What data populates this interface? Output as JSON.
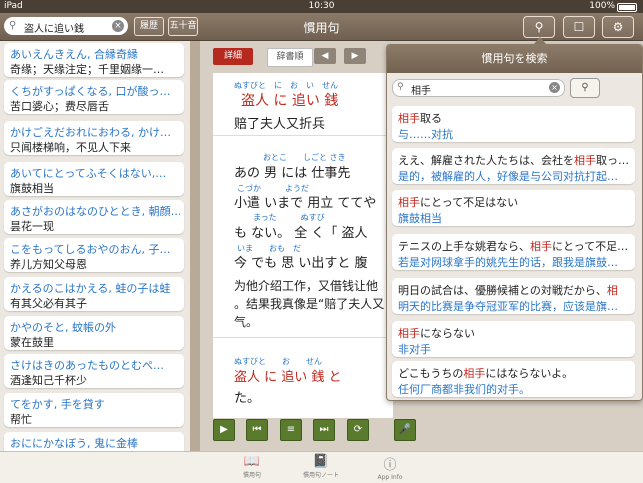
{
  "status": {
    "carrier": "iPad",
    "time": "10:30",
    "battery": "100%"
  },
  "nav": {
    "title": "慣用句",
    "search_value": "盗人に追い銭",
    "history_label": "履歴",
    "gojuon_label": "五十音"
  },
  "list": [
    {
      "reading": "あいえんきえん, 合縁奇縁",
      "meaning": "奇缘；天缘注定；千里姻缘一…"
    },
    {
      "reading": "くちがすっぱくなる, 口が酸っ…",
      "meaning": "苦口婆心；费尽唇舌"
    },
    {
      "reading": "かけごえだおれにおわる, かけ…",
      "meaning": "只闻楼梯响，不见人下来"
    },
    {
      "reading": "あいてにとってふそくはない,…",
      "meaning": "旗鼓相当"
    },
    {
      "reading": "あさがおのはなのひととき, 朝顔…",
      "meaning": "昙花一现"
    },
    {
      "reading": "こをもってしるおやのおん, 子…",
      "meaning": "养儿方知父母恩"
    },
    {
      "reading": "かえるのこはかえる, 蛙の子は蛙",
      "meaning": "有其父必有其子"
    },
    {
      "reading": "かやのそと, 蚊帳の外",
      "meaning": "蒙在鼓里"
    },
    {
      "reading": "さけはきのあったものとむぺ…",
      "meaning": "酒逢知己千杯少"
    },
    {
      "reading": "てをかす, 手を貸す",
      "meaning": "帮忙"
    },
    {
      "reading": "おににかなぼう, 鬼に金棒",
      "meaning": ""
    }
  ],
  "content": {
    "tab_detail": "詳細",
    "tab_dict": "辞書順",
    "prev_label": "◀",
    "next_label": "▶",
    "ruby_title": "ぬすびと　に　お　い　せん",
    "title": "盗人 に 追い 銭",
    "title_cn": "赔了夫人又折兵",
    "ruby1": "おとこ　　しごと さき",
    "line1": "あの 男 には 仕事先",
    "ruby2": "こづか　　　ようだ",
    "line2": "小遣 いまで 用立 ててや",
    "ruby3": "　　まった　　　ぬすび",
    "line3": "も ない。 全 く「 盗人",
    "ruby4": "いま　　おも　だ",
    "line4": "今 でも 思 い出すと 腹",
    "cn1": "为他介绍工作，又借钱让他",
    "cn2": "。结果我真像是“赔了夫人又",
    "cn3": "气。",
    "ruby5": "ぬすびと　　お　　せん",
    "line5": "盗人 に 追い 銭 と",
    "line6": "た。"
  },
  "popover": {
    "title": "慣用句を検索",
    "search_value": "相手",
    "results": [
      {
        "jp_pre": "",
        "jp_hl": "相手",
        "jp_post": "取る",
        "cn": "与……对抗"
      },
      {
        "jp_pre": "ええ、解雇された人たちは、会社を",
        "jp_hl": "相手",
        "jp_post": "取っ…",
        "cn": "是的，被解雇的人，好像是与公司对抗打起…"
      },
      {
        "jp_pre": "",
        "jp_hl": "相手",
        "jp_post": "にとって不足はない",
        "cn": "旗鼓相当"
      },
      {
        "jp_pre": "テニスの上手な姚君なら、",
        "jp_hl": "相手",
        "jp_post": "にとって不足…",
        "cn": "若是对网球拿手的姚先生的话，跟我是旗鼓…"
      },
      {
        "jp_pre": "明日の試合は、優勝候補との対戦だから、",
        "jp_hl": "相",
        "jp_post": "",
        "cn": "明天的比赛是争夺冠亚军的比赛，应该是旗…"
      },
      {
        "jp_pre": "",
        "jp_hl": "相手",
        "jp_post": "にならない",
        "cn": "非对手"
      },
      {
        "jp_pre": "どこもうちの",
        "jp_hl": "相手",
        "jp_post": "にはならないよ。",
        "cn": "任何厂商都非我们的对手。"
      }
    ]
  },
  "tabbar": [
    {
      "label": "慣用句",
      "icon": "book-icon"
    },
    {
      "label": "慣用句ノート",
      "icon": "notebook-icon"
    },
    {
      "label": "App Info",
      "icon": "info-icon"
    }
  ]
}
